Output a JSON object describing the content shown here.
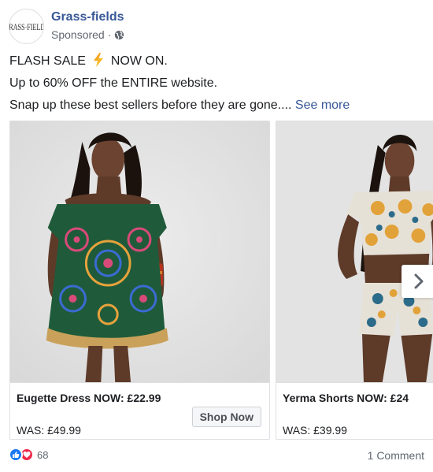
{
  "post": {
    "page_name": "Grass-fields",
    "avatar_text": "GRASS·FIELDS",
    "sponsored_label": "Sponsored",
    "separator": "·",
    "privacy_icon": "globe-icon",
    "text": {
      "line1_before": "FLASH SALE",
      "line1_icon": "lightning-bolt-icon",
      "line1_after": "NOW ON.",
      "line2": "Up to 60% OFF the ENTIRE website.",
      "line3": "Snap up these best sellers before they are gone....",
      "see_more": "See more"
    }
  },
  "carousel": {
    "cards": [
      {
        "title": "Eugette Dress NOW: £22.99",
        "was": "WAS: £49.99",
        "cta": "Shop Now"
      },
      {
        "title": "Yerma Shorts NOW: £24",
        "was": "WAS: £39.99"
      }
    ],
    "next_icon": "chevron-right-icon"
  },
  "engagement": {
    "reaction_icons": [
      "like-icon",
      "love-icon"
    ],
    "reaction_count": "68",
    "comments": "1 Comment"
  },
  "colors": {
    "link": "#385898",
    "like": "#1877f2",
    "love": "#f0284a",
    "bolt": "#f7b928"
  }
}
